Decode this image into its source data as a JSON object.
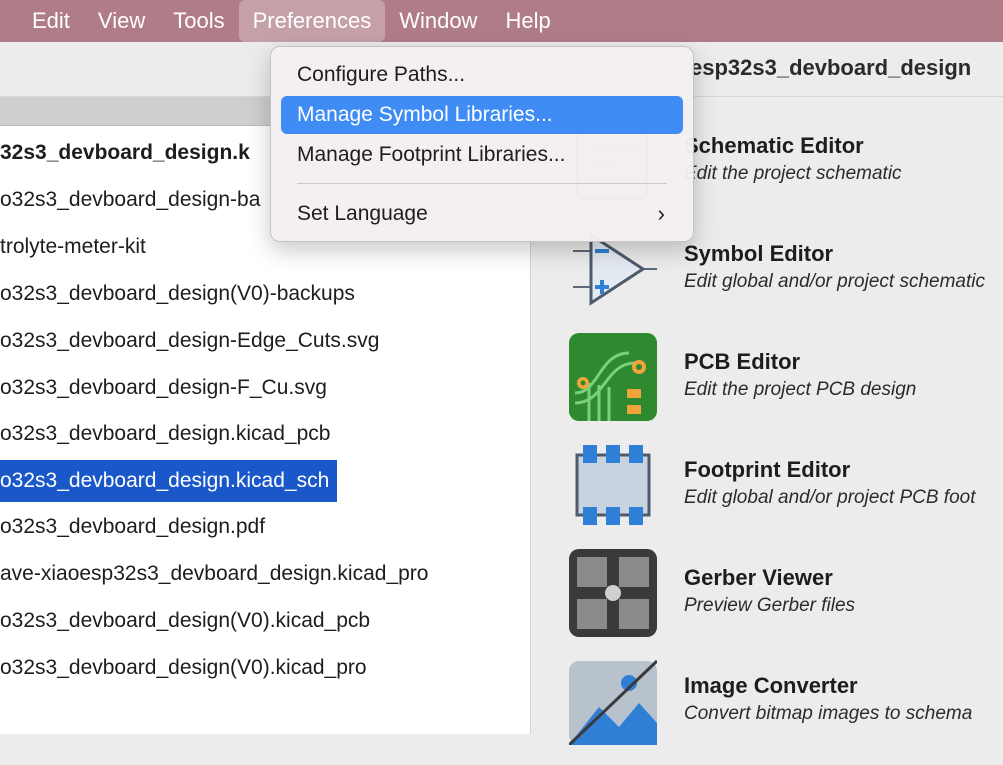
{
  "menubar": {
    "items": [
      "Edit",
      "View",
      "Tools",
      "Preferences",
      "Window",
      "Help"
    ]
  },
  "window": {
    "title": "esp32s3_devboard_design"
  },
  "file_tree": {
    "items": [
      "32s3_devboard_design.k",
      "o32s3_devboard_design-ba",
      "trolyte-meter-kit",
      "o32s3_devboard_design(V0)-backups",
      "o32s3_devboard_design-Edge_Cuts.svg",
      "o32s3_devboard_design-F_Cu.svg",
      "o32s3_devboard_design.kicad_pcb",
      "o32s3_devboard_design.kicad_sch",
      "o32s3_devboard_design.pdf",
      "ave-xiaoesp32s3_devboard_design.kicad_pro",
      "o32s3_devboard_design(V0).kicad_pcb",
      "o32s3_devboard_design(V0).kicad_pro"
    ],
    "selected_index": 7
  },
  "tools": [
    {
      "title": "Schematic Editor",
      "desc": "Edit the project schematic",
      "icon": "schematic-editor-icon"
    },
    {
      "title": "Symbol Editor",
      "desc": "Edit global and/or project schematic",
      "icon": "symbol-editor-icon"
    },
    {
      "title": "PCB Editor",
      "desc": "Edit the project PCB design",
      "icon": "pcb-editor-icon"
    },
    {
      "title": "Footprint Editor",
      "desc": "Edit global and/or project PCB foot",
      "icon": "footprint-editor-icon"
    },
    {
      "title": "Gerber Viewer",
      "desc": "Preview Gerber files",
      "icon": "gerber-viewer-icon"
    },
    {
      "title": "Image Converter",
      "desc": "Convert bitmap images to schema",
      "icon": "image-converter-icon"
    }
  ],
  "preferences_menu": {
    "items": [
      "Configure Paths...",
      "Manage Symbol Libraries...",
      "Manage Footprint Libraries...",
      "Set Language"
    ],
    "highlighted_index": 1,
    "submenu_indicator": "›"
  },
  "colors": {
    "menubar": "#b07c88",
    "selection": "#1a57c9",
    "menu_highlight": "#3f8cf5"
  }
}
